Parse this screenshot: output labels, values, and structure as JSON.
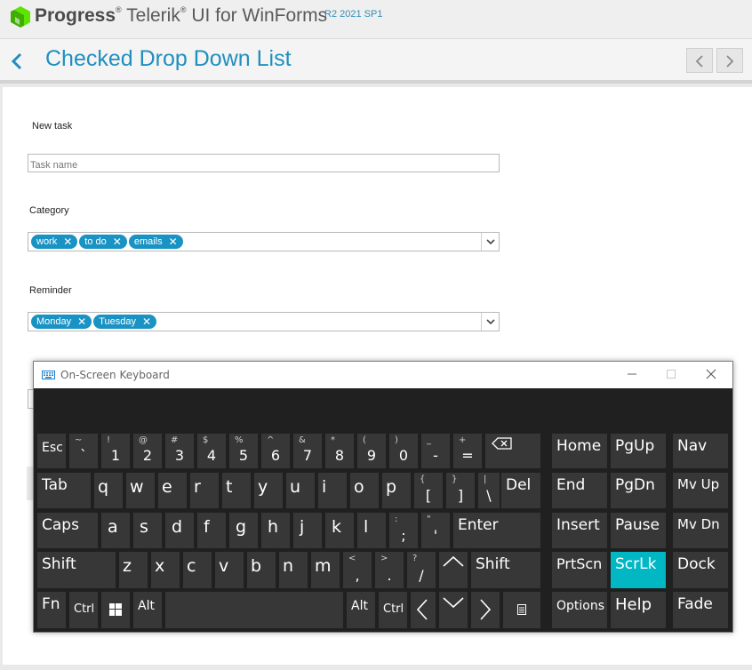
{
  "brand": {
    "company": "Progress",
    "product": "Telerik",
    "product_suffix": "UI for WinForms",
    "version": "R2 2021 SP1",
    "logo_color": "#5ce500"
  },
  "header": {
    "title": "Checked Drop Down List",
    "back_icon": "chevron-left-icon",
    "prev_icon": "chevron-left-icon",
    "next_icon": "chevron-right-icon"
  },
  "form": {
    "section_title": "New task",
    "task_name": {
      "value": "",
      "placeholder": "Task name"
    },
    "category": {
      "label": "Category",
      "tokens": [
        {
          "text": "work",
          "remove": "✕"
        },
        {
          "text": "to do",
          "remove": "✕"
        },
        {
          "text": "emails",
          "remove": "✕"
        }
      ]
    },
    "reminder": {
      "label": "Reminder",
      "tokens": [
        {
          "text": "Monday",
          "remove": "✕"
        },
        {
          "text": "Tuesday",
          "remove": "✕"
        }
      ]
    },
    "token_color": "#1993c4"
  },
  "osk": {
    "title": "On-Screen Keyboard",
    "highlight_color": "#00b7c3",
    "row1": {
      "esc": "Esc",
      "keys": [
        {
          "sec": "~",
          "pri": "`"
        },
        {
          "sec": "!",
          "pri": "1"
        },
        {
          "sec": "@",
          "pri": "2"
        },
        {
          "sec": "#",
          "pri": "3"
        },
        {
          "sec": "$",
          "pri": "4"
        },
        {
          "sec": "%",
          "pri": "5"
        },
        {
          "sec": "^",
          "pri": "6"
        },
        {
          "sec": "&",
          "pri": "7"
        },
        {
          "sec": "*",
          "pri": "8"
        },
        {
          "sec": "(",
          "pri": "9"
        },
        {
          "sec": ")",
          "pri": "0"
        },
        {
          "sec": "_",
          "pri": "-"
        },
        {
          "sec": "+",
          "pri": "="
        }
      ],
      "backspace_icon": "backspace-icon"
    },
    "row2": {
      "tab": "Tab",
      "letters": [
        "q",
        "w",
        "e",
        "r",
        "t",
        "y",
        "u",
        "i",
        "o",
        "p"
      ],
      "brackets": [
        {
          "sec": "{",
          "pri": "["
        },
        {
          "sec": "}",
          "pri": "]"
        },
        {
          "sec": "|",
          "pri": "\\"
        }
      ],
      "del": "Del"
    },
    "row3": {
      "caps": "Caps",
      "letters": [
        "a",
        "s",
        "d",
        "f",
        "g",
        "h",
        "j",
        "k",
        "l"
      ],
      "punct": [
        {
          "sec": ":",
          "pri": ";"
        },
        {
          "sec": "\"",
          "pri": "'"
        }
      ],
      "enter": "Enter"
    },
    "row4": {
      "shift_left": "Shift",
      "letters": [
        "z",
        "x",
        "c",
        "v",
        "b",
        "n",
        "m"
      ],
      "punct": [
        {
          "sec": "<",
          "pri": ","
        },
        {
          "sec": ">",
          "pri": "."
        },
        {
          "sec": "?",
          "pri": "/"
        }
      ],
      "up_icon": "arrow-up-icon",
      "shift_right": "Shift"
    },
    "row5": {
      "fn": "Fn",
      "ctrl_left": "Ctrl",
      "win_icon": "windows-icon",
      "alt_left": "Alt",
      "alt_right": "Alt",
      "ctrl_right": "Ctrl",
      "left_icon": "arrow-left-icon",
      "down_icon": "arrow-down-icon",
      "right_icon": "arrow-right-icon",
      "menu_icon": "context-menu-icon"
    },
    "nav_pad": {
      "home": "Home",
      "pgup": "PgUp",
      "nav": "Nav",
      "end": "End",
      "pgdn": "PgDn",
      "mvup": "Mv Up",
      "insert": "Insert",
      "pause": "Pause",
      "mvdn": "Mv Dn",
      "prtscn": "PrtScn",
      "scrlk": "ScrLk",
      "dock": "Dock",
      "options": "Options",
      "help": "Help",
      "fade": "Fade"
    }
  }
}
